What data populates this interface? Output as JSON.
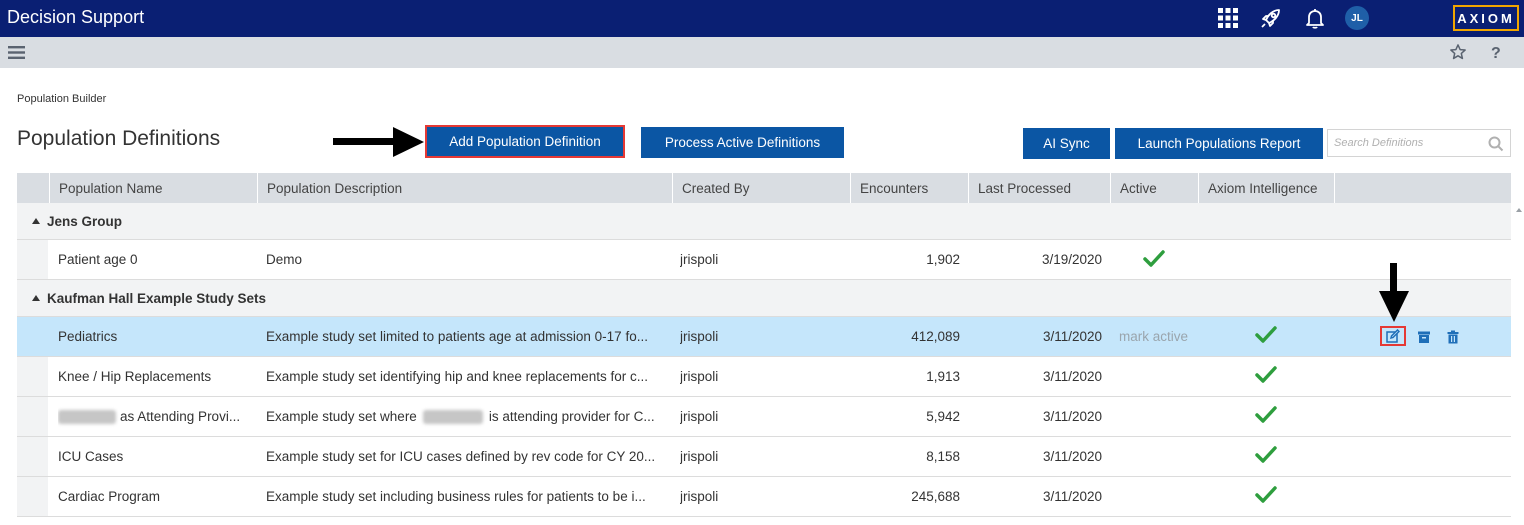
{
  "app": {
    "title": "Decision Support",
    "user_initials": "JL",
    "logo_text": "AXIOM",
    "brand_color": "#0a1f73",
    "accent_color": "#f0a500"
  },
  "topbar_icons": [
    "apps-grid-icon",
    "rocket-icon",
    "bell-icon"
  ],
  "toolbar_icons": [
    "hamburger-menu-icon",
    "star-icon",
    "help-icon"
  ],
  "breadcrumb": "Population Builder",
  "page_title": "Population Definitions",
  "buttons": {
    "add_population": "Add Population Definition",
    "process_active": "Process Active Definitions",
    "ai_sync": "AI Sync",
    "launch_report": "Launch Populations Report"
  },
  "search": {
    "placeholder": "Search Definitions",
    "value": ""
  },
  "columns": [
    "Population Name",
    "Population Description",
    "Created By",
    "Encounters",
    "Last Processed",
    "Active",
    "Axiom Intelligence"
  ],
  "groups": [
    {
      "label": "Jens Group",
      "rows": [
        {
          "name": "Patient age 0",
          "description": "Demo",
          "created_by": "jrispoli",
          "encounters": "1,902",
          "last_processed": "3/19/2020",
          "active": true,
          "active_text": "",
          "ai": false,
          "selected": false,
          "redacted_name": false,
          "redacted_desc": false
        }
      ]
    },
    {
      "label": "Kaufman Hall Example Study Sets",
      "rows": [
        {
          "name": "Pediatrics",
          "description": "Example study set limited to patients age at admission 0-17 fo...",
          "created_by": "jrispoli",
          "encounters": "412,089",
          "last_processed": "3/11/2020",
          "active": false,
          "active_text": "mark active",
          "ai": true,
          "selected": true,
          "redacted_name": false,
          "redacted_desc": false
        },
        {
          "name": "Knee / Hip Replacements",
          "description": "Example study set identifying hip and knee replacements for c...",
          "created_by": "jrispoli",
          "encounters": "1,913",
          "last_processed": "3/11/2020",
          "active": false,
          "active_text": "",
          "ai": true,
          "selected": false,
          "redacted_name": false,
          "redacted_desc": false
        },
        {
          "name": "as Attending Provi...",
          "description_before": "Example study set where",
          "description_after": "is attending provider for C...",
          "created_by": "jrispoli",
          "encounters": "5,942",
          "last_processed": "3/11/2020",
          "active": false,
          "active_text": "",
          "ai": true,
          "selected": false,
          "redacted_name": true,
          "redacted_desc": true
        },
        {
          "name": "ICU Cases",
          "description": "Example study set for ICU cases defined by rev code for CY 20...",
          "created_by": "jrispoli",
          "encounters": "8,158",
          "last_processed": "3/11/2020",
          "active": false,
          "active_text": "",
          "ai": true,
          "selected": false,
          "redacted_name": false,
          "redacted_desc": false
        },
        {
          "name": "Cardiac Program",
          "description": "Example study set including business rules for patients to be i...",
          "created_by": "jrispoli",
          "encounters": "245,688",
          "last_processed": "3/11/2020",
          "active": false,
          "active_text": "",
          "ai": true,
          "selected": false,
          "redacted_name": false,
          "redacted_desc": false
        }
      ]
    }
  ],
  "row_actions": [
    "edit-icon",
    "archive-icon",
    "delete-icon"
  ],
  "status_colors": {
    "check": "#2e9e3e",
    "selected_row": "#c5e6fb",
    "highlight_outline": "#e53935"
  }
}
